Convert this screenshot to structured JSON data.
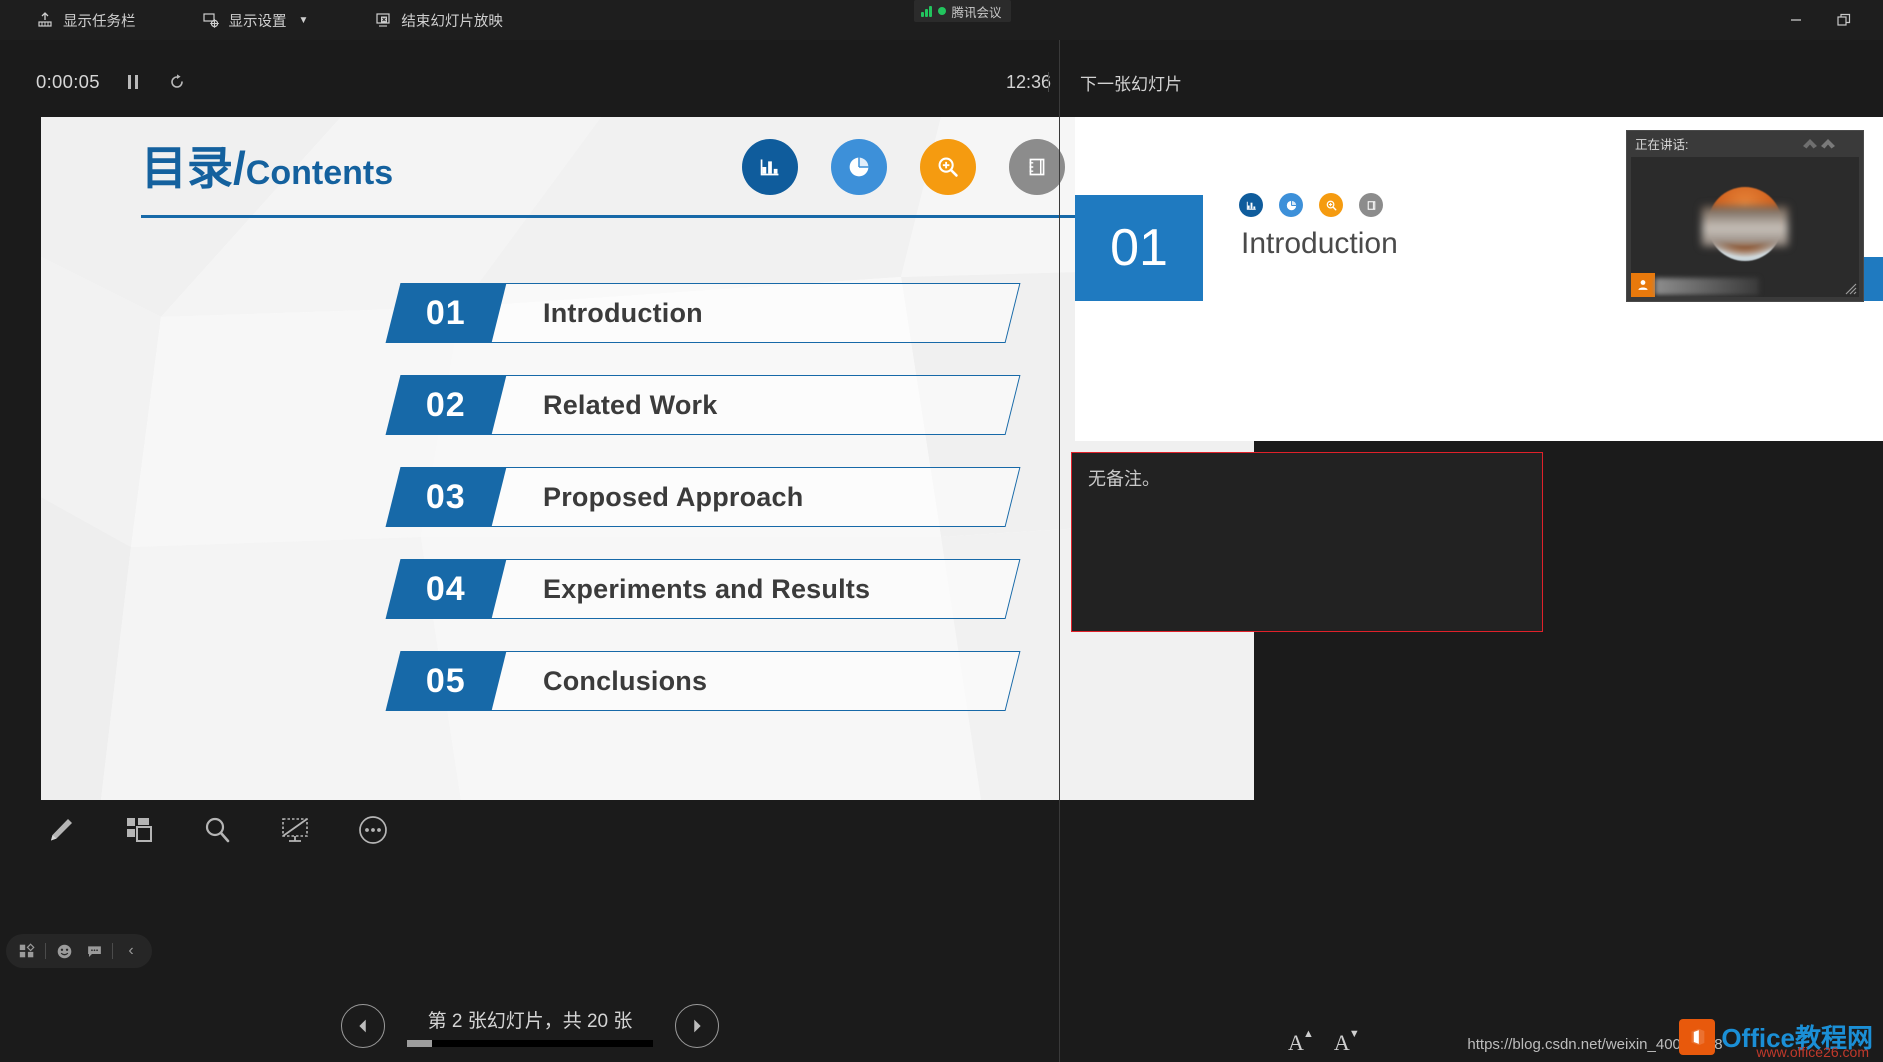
{
  "topbar": {
    "items": [
      {
        "label": "显示任务栏",
        "icon": "taskbar-icon",
        "has_caret": false
      },
      {
        "label": "显示设置",
        "icon": "display-settings-icon",
        "has_caret": true,
        "caret": "▼"
      },
      {
        "label": "结束幻灯片放映",
        "icon": "end-show-icon",
        "has_caret": false
      }
    ],
    "meeting_badge": {
      "label": "腾讯会议",
      "status_color": "#22c55e"
    },
    "window_controls": {
      "minimize": "—",
      "restore": "❐"
    }
  },
  "presenter": {
    "timer": "0:00:05",
    "pause_label": "暂停",
    "reset_label": "重新开始",
    "clock": "12:36",
    "next_slide_label": "下一张幻灯片"
  },
  "slide": {
    "title_cn": "目录",
    "title_slash": "/",
    "title_en": "Contents",
    "icons": [
      {
        "name": "bar-chart-icon",
        "color": "#0f5c9c"
      },
      {
        "name": "pie-chart-icon",
        "color": "#3d90d9"
      },
      {
        "name": "zoom-in-icon",
        "color": "#f59b10"
      },
      {
        "name": "notebook-icon",
        "color": "#8c8c8c"
      },
      {
        "name": "checklist-icon",
        "color": "#0f5c9c"
      }
    ],
    "contents": [
      {
        "number": "01",
        "label": "Introduction"
      },
      {
        "number": "02",
        "label": "Related Work"
      },
      {
        "number": "03",
        "label": "Proposed Approach"
      },
      {
        "number": "04",
        "label": "Experiments and Results"
      },
      {
        "number": "05",
        "label": "Conclusions"
      }
    ],
    "accent_color": "#1769a8"
  },
  "slide_tools": [
    {
      "name": "pen-icon",
      "label": "笔"
    },
    {
      "name": "all-slides-icon",
      "label": "查看所有幻灯片"
    },
    {
      "name": "zoom-icon",
      "label": "放大"
    },
    {
      "name": "black-screen-icon",
      "label": "黑屏"
    },
    {
      "name": "more-options-icon",
      "label": "更多幻灯片放映选项"
    }
  ],
  "mini_toolbar": [
    {
      "name": "apps-icon"
    },
    {
      "name": "emoji-icon"
    },
    {
      "name": "chat-icon"
    },
    {
      "name": "collapse-chevron-icon",
      "glyph": "‹"
    }
  ],
  "slide_nav": {
    "prev_label": "上一张",
    "next_label": "下一张",
    "status": "第 2 张幻灯片，共 20 张",
    "current": 2,
    "total": 20,
    "progress_percent": 10
  },
  "next_preview": {
    "number": "01",
    "text": "Introduction"
  },
  "notes": {
    "text": "无备注。",
    "border_color": "#e0212a",
    "font_bigger": "A",
    "font_smaller": "A"
  },
  "speaker_window": {
    "title": "正在讲话:",
    "logo_name": "tencent-meeting-logo"
  },
  "footer": {
    "url": "https://blog.csdn.net/weixin_40024448",
    "watermark_brand": "Office教程网",
    "watermark_sub": "www.office26.com"
  }
}
